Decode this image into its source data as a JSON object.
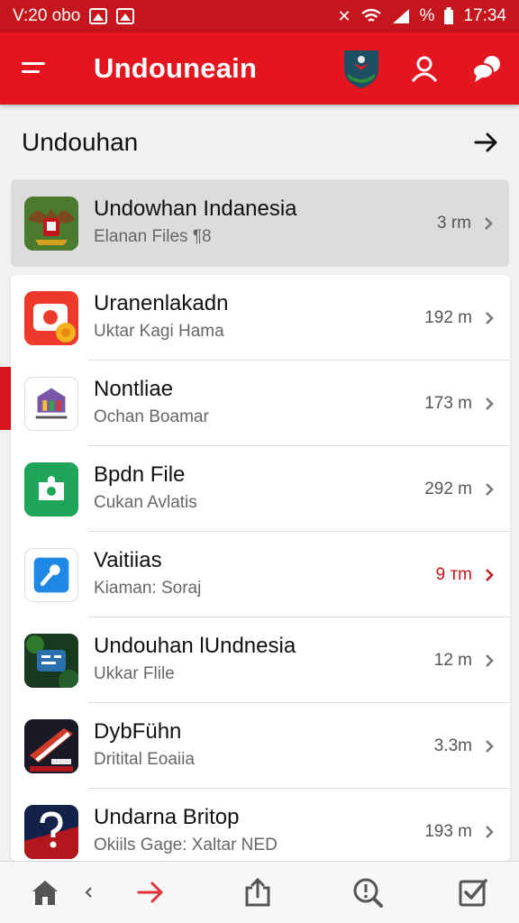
{
  "status_bar": {
    "left_text": "V:20 obo",
    "time": "17:34",
    "battery_text": "%",
    "colors": {
      "background": "#c4161c"
    }
  },
  "app_bar": {
    "title": "Undouneain",
    "icons": [
      "menu-icon",
      "garuda-shield-icon",
      "profile-icon",
      "chat-icon"
    ],
    "color": "#e3151f"
  },
  "section": {
    "title": "Undouhan",
    "action_icon": "arrow-right-icon"
  },
  "items": [
    {
      "title": "Undowhan Indanesia",
      "subtitle": "Elanan Files ¶8",
      "size": "3 rm",
      "icon": "garuda-emblem-icon",
      "highlighted": true
    },
    {
      "title": "Uranenlakadn",
      "subtitle": "Uktar Kagi Hama",
      "size": "192 m",
      "icon": "camera-app-icon"
    },
    {
      "title": "Nontliae",
      "subtitle": "Ochan Boamar",
      "size": "173 m",
      "icon": "building-app-icon"
    },
    {
      "title": "Bpdn File",
      "subtitle": "Cukan Avlatis",
      "size": "292 m",
      "icon": "green-puzzle-icon"
    },
    {
      "title": "Vaitiias",
      "subtitle": "Kiaman: Soraj",
      "size": "9 тm",
      "icon": "blue-tool-icon",
      "size_accent": true
    },
    {
      "title": "Undouhan lUndnesia",
      "subtitle": "Ukkar Flile",
      "size": "12 m",
      "icon": "chat-app-icon"
    },
    {
      "title": "DybFühn",
      "subtitle": "Dritital Eoaiia",
      "size": "3.3m",
      "icon": "flag-app-icon"
    },
    {
      "title": "Undarna Britop",
      "subtitle": "Okiils Gage: Xaltar NED",
      "size": "193 m",
      "icon": "question-app-icon"
    }
  ],
  "bottom_nav": {
    "items": [
      "home-icon",
      "back-chevron-icon",
      "forward-arrow-icon",
      "share-icon",
      "search-icon",
      "checkbox-icon"
    ]
  }
}
